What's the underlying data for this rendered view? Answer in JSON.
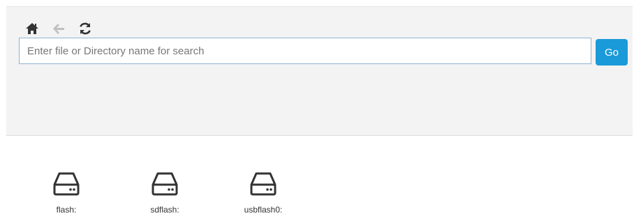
{
  "toolbar": {
    "home_icon": "home-icon",
    "back_icon": "back-arrow-icon",
    "refresh_icon": "refresh-icon"
  },
  "search": {
    "placeholder": "Enter file or Directory name for search",
    "value": "",
    "button_label": "Go"
  },
  "drives": [
    {
      "label": "flash:",
      "icon": "hard-drive-icon"
    },
    {
      "label": "sdflash:",
      "icon": "hard-drive-icon"
    },
    {
      "label": "usbflash0:",
      "icon": "hard-drive-icon"
    }
  ],
  "colors": {
    "panel_background": "#f3f3f3",
    "accent": "#1a9ad8",
    "icon_dark": "#333333",
    "icon_muted": "#bfbfbf"
  }
}
